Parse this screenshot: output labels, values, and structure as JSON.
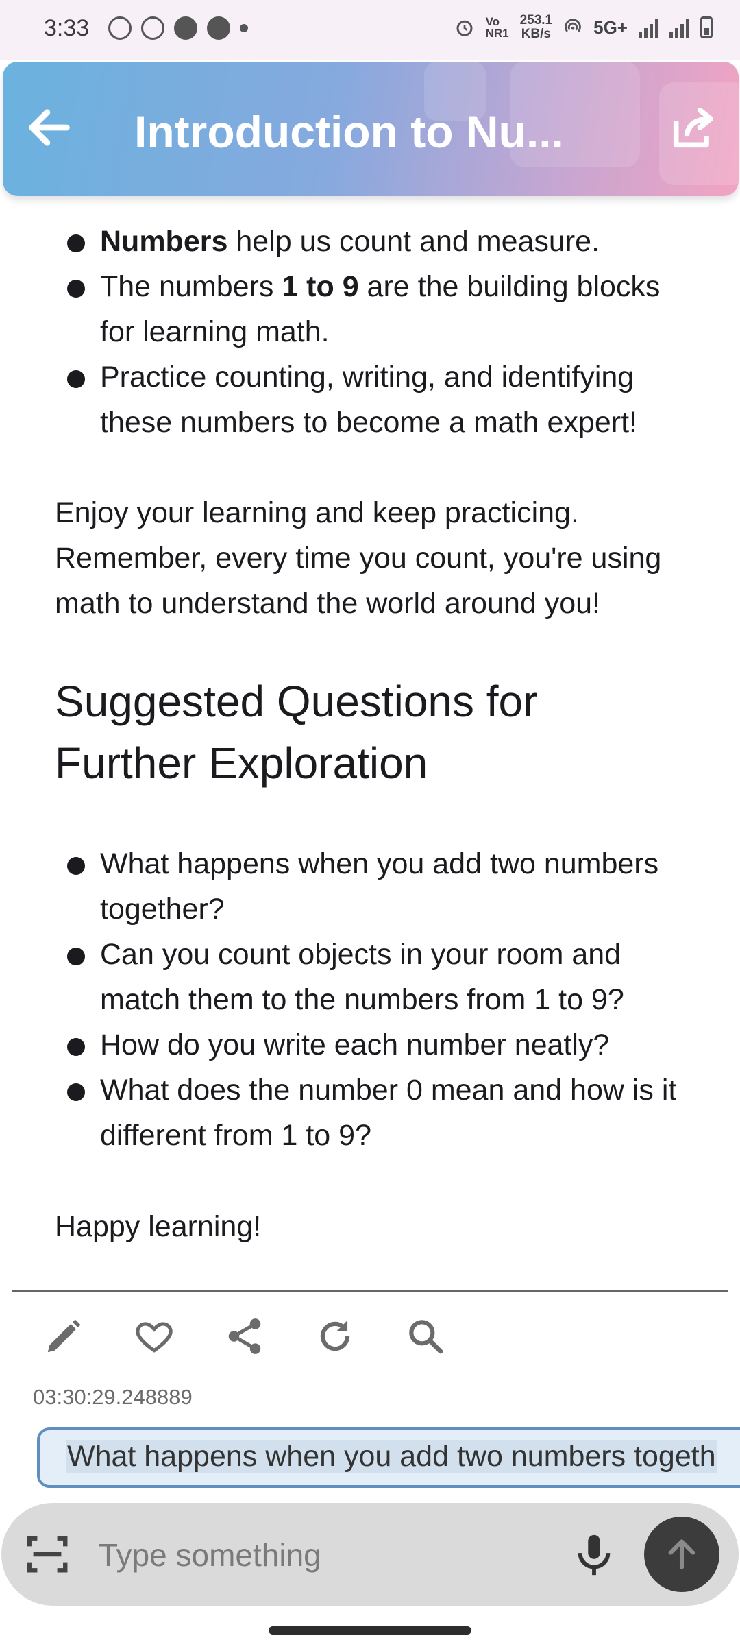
{
  "status_bar": {
    "time": "3:33",
    "speed_value": "253.1",
    "speed_unit": "KB/s",
    "network": "5G+",
    "icons_left": [
      "whatsapp-icon",
      "app-icon",
      "app-icon",
      "app-icon",
      "more-dot"
    ],
    "icons_right": [
      "alarm-icon",
      "volte-icon",
      "hotspot-icon",
      "signal-icon",
      "signal-icon",
      "battery-icon"
    ]
  },
  "app_bar": {
    "title": "Introduction to Nu...",
    "back_icon": "arrow-left-icon",
    "share_icon": "share-external-icon"
  },
  "content": {
    "bullets_top": [
      {
        "bold": "Numbers",
        "rest": " help us count and measure."
      },
      {
        "pre": "The numbers ",
        "bold": "1 to 9",
        "rest": " are the building blocks for learning math."
      },
      {
        "pre": "",
        "bold": "",
        "rest": "Practice counting, writing, and identifying these numbers to become a math expert!"
      }
    ],
    "paragraph": "Enjoy your learning and keep practicing. Remember, every time you count, you're using math to understand the world around you!",
    "heading": "Suggested Questions for Further Exploration",
    "questions": [
      "What happens when you add two numbers together?",
      "Can you count objects in your room and match them to the numbers from 1 to 9?",
      "How do you write each number neatly?",
      "What does the number 0 mean and how is it different from 1 to 9?"
    ],
    "closing": "Happy learning!"
  },
  "actions": {
    "icons": [
      "pencil-icon",
      "heart-icon",
      "share-icon",
      "refresh-icon",
      "search-icon"
    ],
    "timestamp": "03:30:29.248889"
  },
  "suggestion_chip": "What happens when you add two numbers togeth",
  "composer": {
    "placeholder": "Type something",
    "value": "",
    "scan_icon": "scan-icon",
    "mic_icon": "mic-icon",
    "send_icon": "arrow-up-icon"
  },
  "colors": {
    "app_bar_gradient_start": "#6ab2df",
    "app_bar_gradient_end": "#f2a3c2",
    "chip_border": "#5f8fbf",
    "send_button": "#3c3c3c"
  }
}
